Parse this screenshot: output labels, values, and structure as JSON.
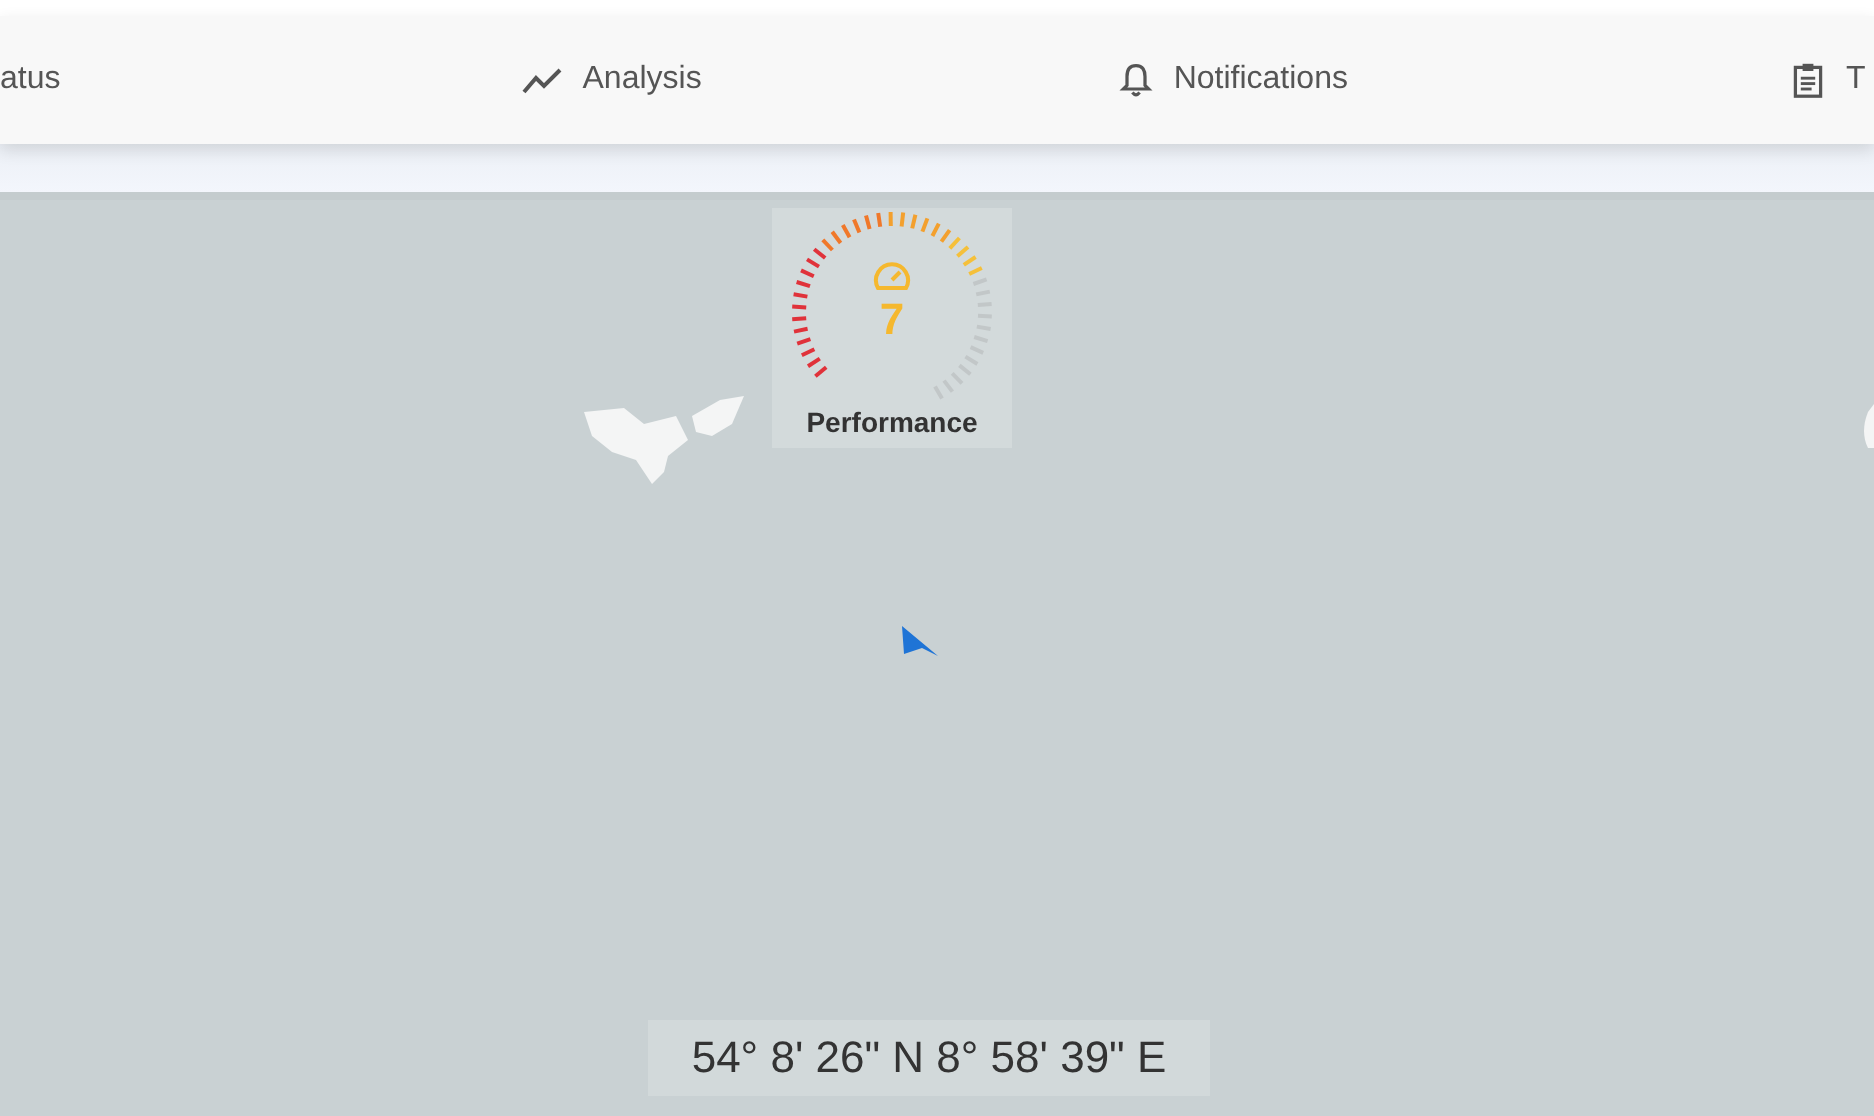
{
  "tabs": [
    {
      "label": "atus"
    },
    {
      "label": "Analysis"
    },
    {
      "label": "Notifications"
    },
    {
      "label": "T"
    }
  ],
  "gauge": {
    "value": "7",
    "label": "Performance",
    "level": 0.7
  },
  "coordinates": "54° 8' 26\" N 8° 58' 39\" E"
}
